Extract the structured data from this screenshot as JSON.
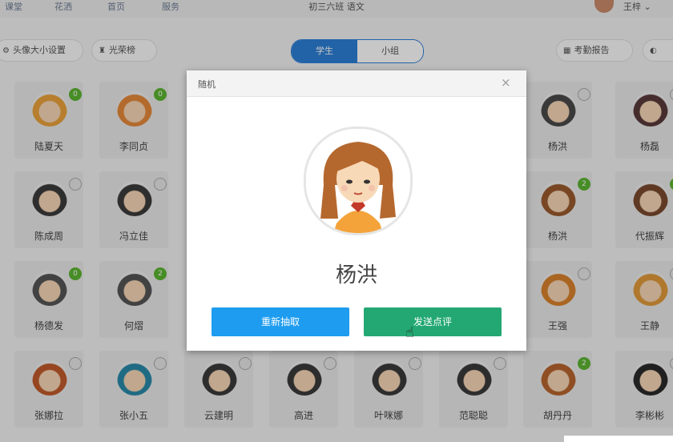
{
  "topbar": {
    "nav": [
      "课堂",
      "花洒",
      "首页",
      "服务"
    ],
    "title": "初三六班 语文",
    "user": "王梓 ⌄"
  },
  "toolbar": {
    "avatar_setting": "头像大小设置",
    "leaderboard": "光荣榜",
    "tab_students": "学生",
    "tab_groups": "小组",
    "report": "考勤报告",
    "more": "◐"
  },
  "students": [
    {
      "name": "陆夏天",
      "badge": "0",
      "color": "#e9a23b"
    },
    {
      "name": "李同贞",
      "badge": "0",
      "color": "#e6893a"
    },
    {
      "name": "杨洪",
      "badge": "",
      "color": "#4a4a4a"
    },
    {
      "name": "杨磊",
      "badge": "",
      "color": "#5a3a3a"
    },
    {
      "name": "陈成周",
      "badge": "",
      "color": "#3b3b3b"
    },
    {
      "name": "冯立佳",
      "badge": "",
      "color": "#3b3b3b"
    },
    {
      "name": "杨洪",
      "badge": "2",
      "color": "#9a5a2e"
    },
    {
      "name": "代振辉",
      "badge": "2",
      "color": "#7a4a2e"
    },
    {
      "name": "杨德发",
      "badge": "0",
      "color": "#555"
    },
    {
      "name": "何熠",
      "badge": "2",
      "color": "#555"
    },
    {
      "name": "王强",
      "badge": "",
      "color": "#d9822b"
    },
    {
      "name": "王静",
      "badge": "",
      "color": "#e09a3a"
    },
    {
      "name": "张娜拉",
      "badge": "",
      "color": "#c05a2a"
    },
    {
      "name": "张小五",
      "badge": "",
      "color": "#2a8aa8"
    },
    {
      "name": "云建明",
      "badge": "",
      "color": "#3a3a3a"
    },
    {
      "name": "高进",
      "badge": "",
      "color": "#3a3a3a"
    },
    {
      "name": "叶咪娜",
      "badge": "",
      "color": "#3a3a3a"
    },
    {
      "name": "范聪聪",
      "badge": "",
      "color": "#3a3a3a"
    },
    {
      "name": "胡丹丹",
      "badge": "2",
      "color": "#b8652e"
    },
    {
      "name": "李彬彬",
      "badge": "",
      "color": "#2a2a2a"
    }
  ],
  "modal": {
    "title": "随机",
    "close": "×",
    "student_name": "杨洪",
    "redraw_label": "重新抽取",
    "send_label": "发送点评"
  },
  "colors": {
    "primary": "#2c7fd6",
    "redraw": "#1e9cf0",
    "send": "#23a873",
    "badge_green": "#5cb531"
  }
}
